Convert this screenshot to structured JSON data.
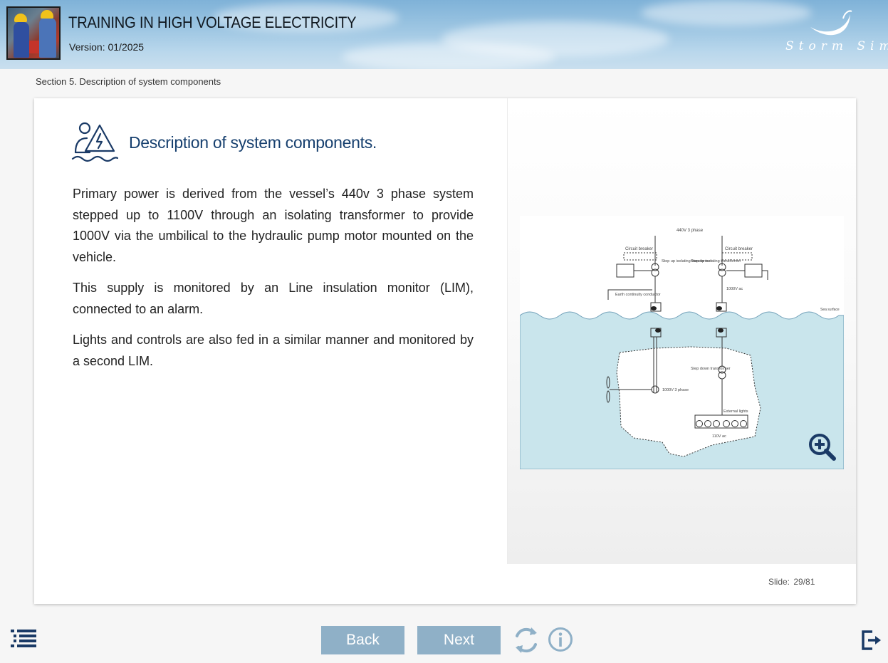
{
  "header": {
    "title": "TRAINING IN HIGH VOLTAGE ELECTRICITY",
    "version": "Version: 01/2025",
    "logo_text": "Storm Sim"
  },
  "breadcrumb": "Section 5. Description of system components",
  "slide": {
    "heading": "Description of system components.",
    "paragraphs": [
      "Primary power is derived from the vessel’s 440v 3 phase system stepped up to 1100V through an isolating transformer to provide 1000V via the umbilical to the hydraulic pump motor mounted on the vehicle.",
      "This supply is monitored by an Line insulation monitor (LIM), connected to an alarm.",
      "Lights and controls are also fed in a similar manner and monitored by a second LIM."
    ],
    "diagram_labels": {
      "supply": "440V 3 phase",
      "cb_left": "Circuit breaker",
      "cb_right": "Circuit breaker",
      "lim": "Line insulation monitor",
      "stepup_left": "Step up isolating transformer",
      "stepup_right": "Step up isolating transformer",
      "earth": "Earth continuity conductor",
      "v1000ac": "1000V ac",
      "sea_surface": "Sea surface",
      "stepdown": "Step down transformer",
      "motor": "1000V 3 phase",
      "external_lights": "External lights",
      "v110ac": "110V ac"
    },
    "counter_label": "Slide:",
    "counter_value": "29/81"
  },
  "footer": {
    "back_label": "Back",
    "next_label": "Next"
  },
  "icons": {
    "menu": "list-menu-icon",
    "refresh": "refresh-icon",
    "info": "info-icon",
    "exit": "exit-icon",
    "zoom": "zoom-in-icon",
    "section": "worker-electric-sea-icon"
  },
  "colors": {
    "heading": "#17406f",
    "nav_button": "#8fb0c7",
    "icon_dark": "#1a3a66",
    "sea": "#c9e5ec"
  }
}
